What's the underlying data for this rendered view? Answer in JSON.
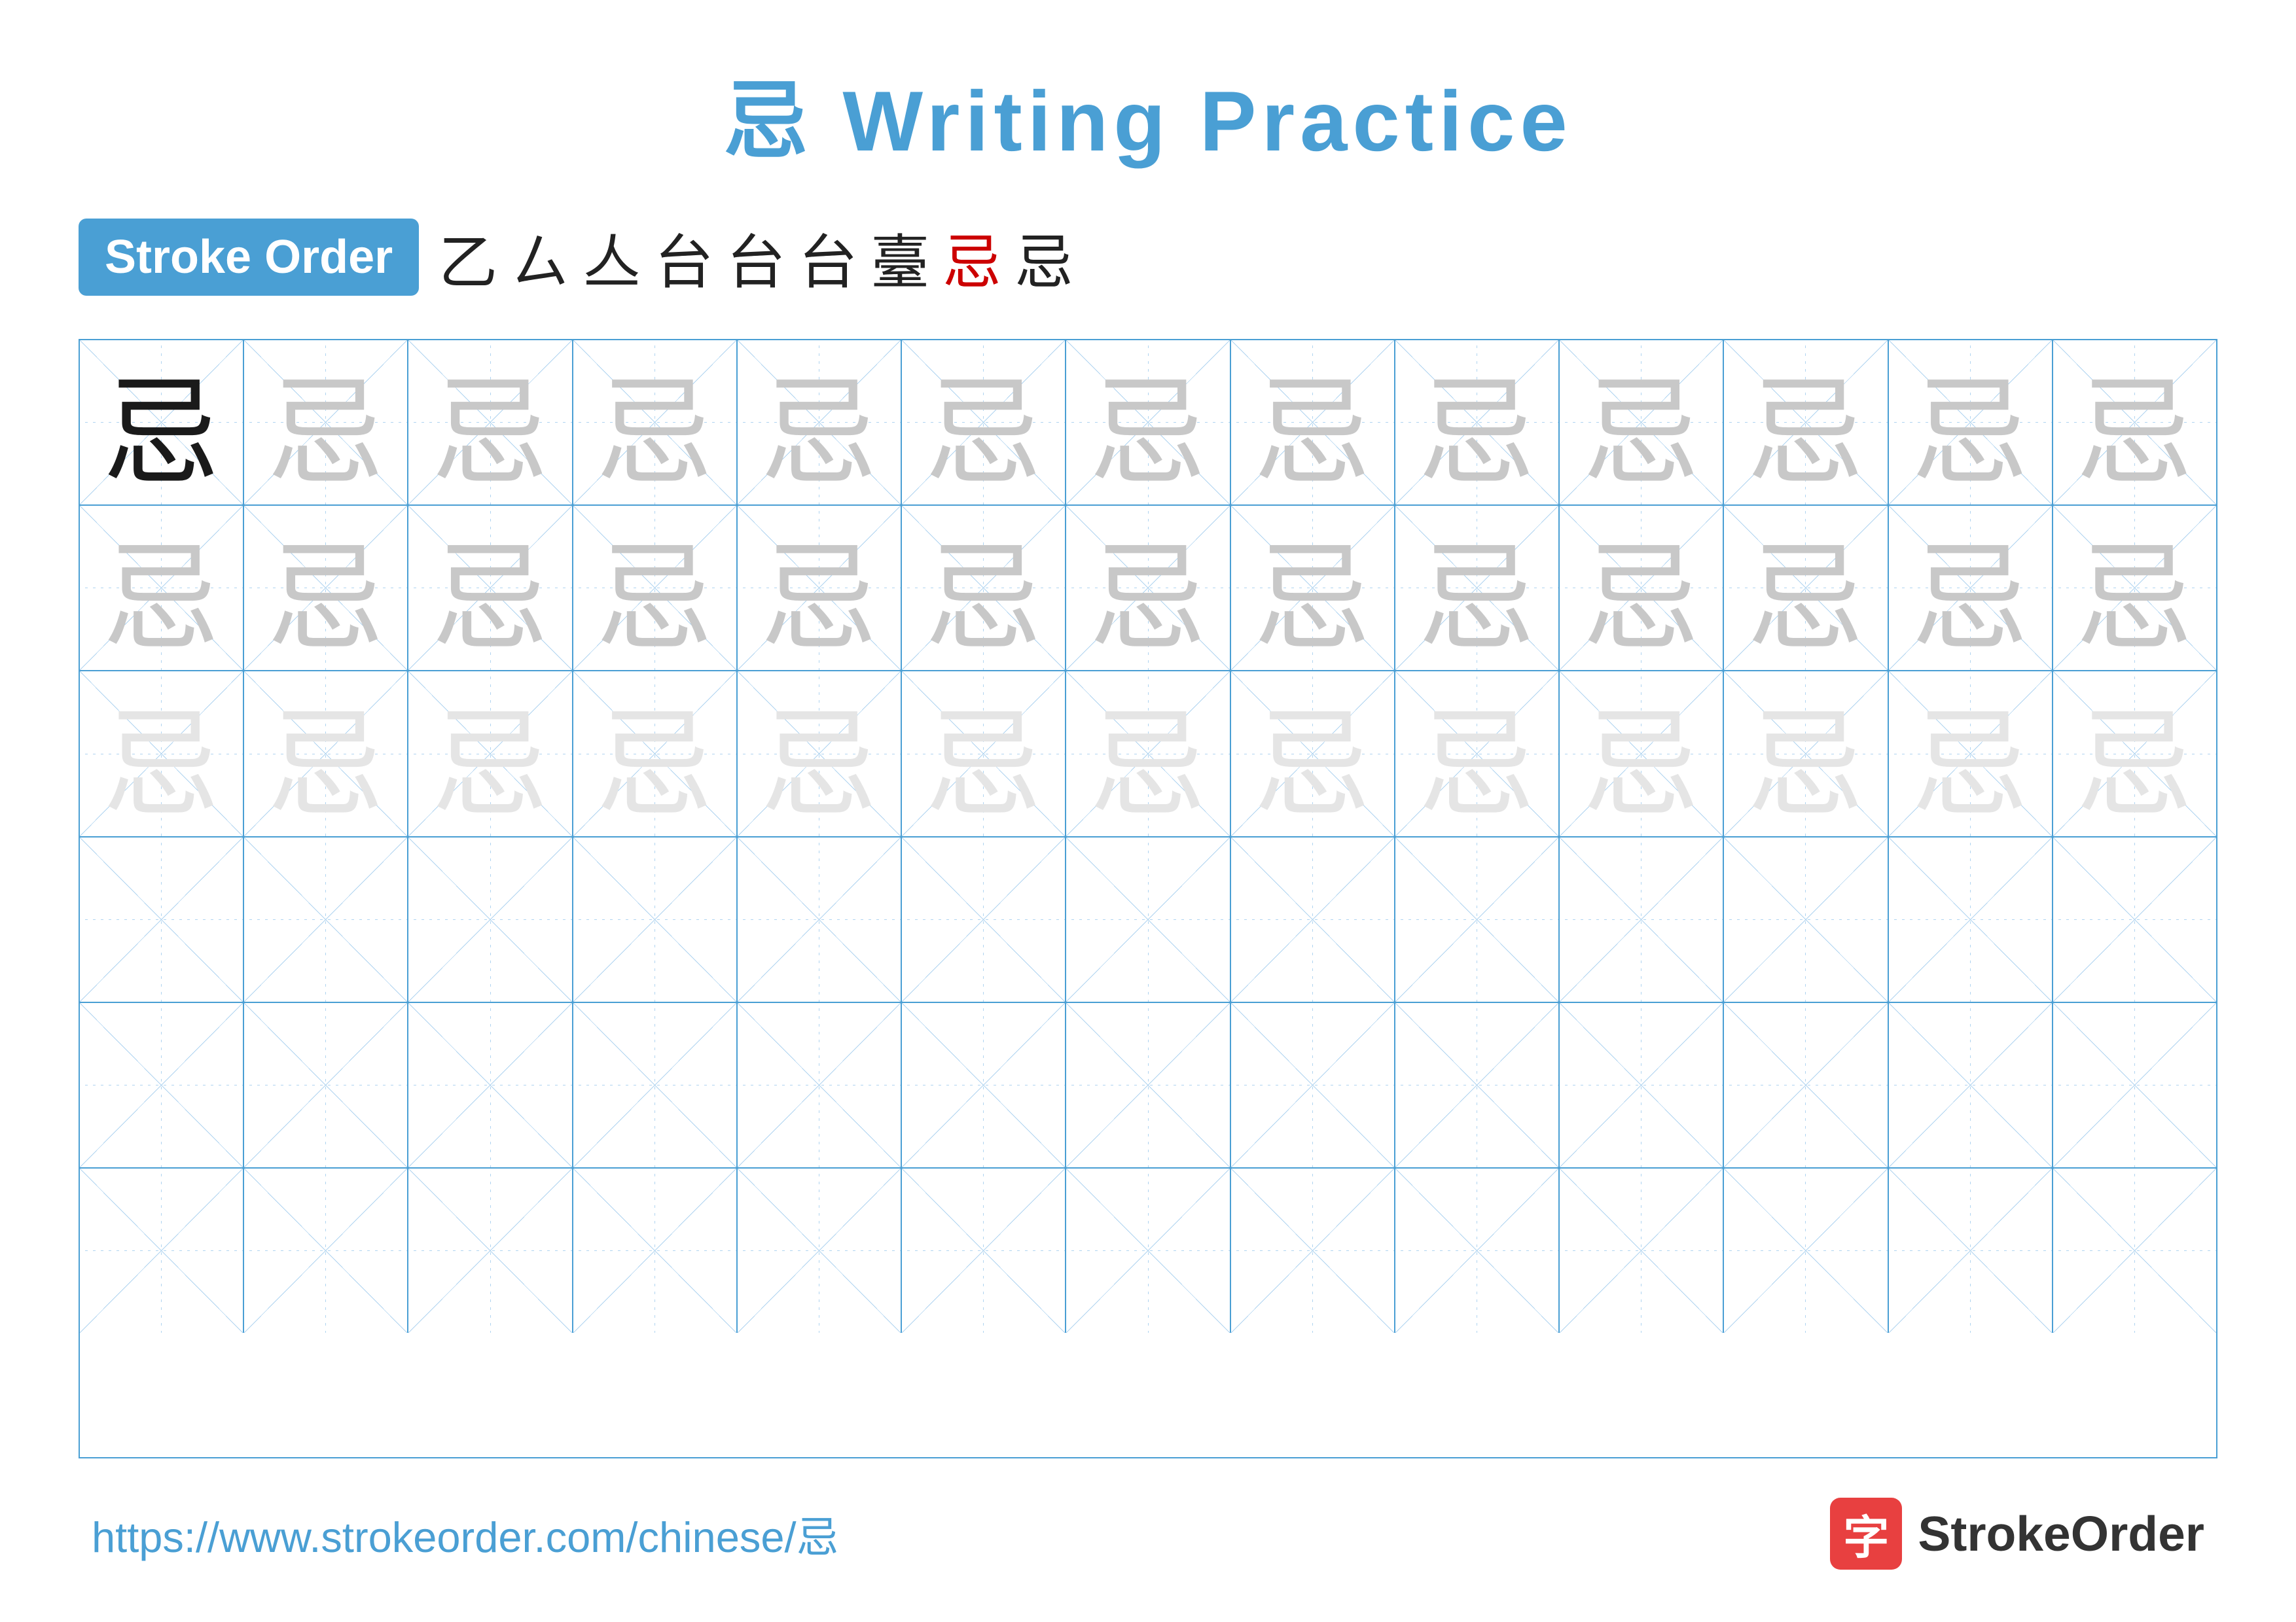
{
  "title": {
    "char": "忌",
    "text": " Writing Practice",
    "full": "忌 Writing Practice"
  },
  "stroke_order": {
    "badge_label": "Stroke Order",
    "strokes": [
      "乙",
      "ㄙ",
      "亼",
      "台",
      "台",
      "台",
      "臺",
      "忌",
      "忌"
    ]
  },
  "grid": {
    "rows": 6,
    "cols": 13,
    "char": "忌",
    "row_types": [
      "dark_then_light",
      "light",
      "lighter",
      "empty",
      "empty",
      "empty"
    ]
  },
  "footer": {
    "url": "https://www.strokeorder.com/chinese/忌",
    "logo_text": "StrokeOrder",
    "logo_char": "字"
  }
}
